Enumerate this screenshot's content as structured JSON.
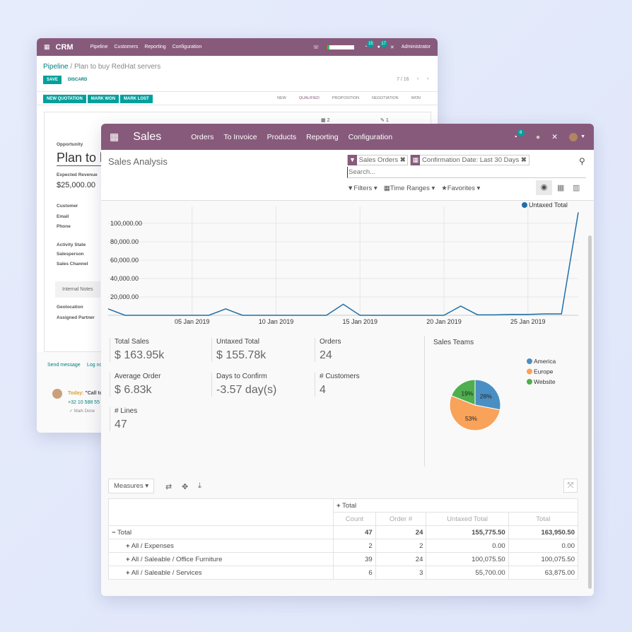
{
  "crm": {
    "app": "CRM",
    "menu": [
      "Pipeline",
      "Customers",
      "Reporting",
      "Configuration"
    ],
    "user": "Administrator",
    "badges": [
      "15",
      "17"
    ],
    "breadcrumb_root": "Pipeline",
    "breadcrumb_current": "Plan to buy RedHat servers",
    "save": "SAVE",
    "discard": "DISCARD",
    "pager": "7 / 16",
    "actions": [
      "NEW QUOTATION",
      "MARK WON",
      "MARK LOST"
    ],
    "stages": [
      "NEW",
      "QUALIFIED",
      "PROPOSITION",
      "NEGOTIATION",
      "WON"
    ],
    "active_stage": "QUALIFIED",
    "stat_buttons": [
      "2",
      "1"
    ],
    "opportunity_label": "Opportunity",
    "opportunity_name": "Plan to buy RedHat servers",
    "expected_revenue_label": "Expected Revenue",
    "expected_revenue": "$25,000.00",
    "fields": [
      "Customer",
      "Email",
      "Phone"
    ],
    "fields2": [
      "Activity State",
      "Salesperson",
      "Sales Channel"
    ],
    "notes_tab": "Internal Notes",
    "fields3": [
      "Geolocation",
      "Assigned Partner"
    ],
    "send_message": "Send message",
    "log_note": "Log note",
    "activity_today": "Today:",
    "activity_title": "\"Call to",
    "activity_phone": "+32 10 588 55",
    "mark_done": "✓ Mark Done"
  },
  "sales": {
    "app": "Sales",
    "menu": [
      "Orders",
      "To Invoice",
      "Products",
      "Reporting",
      "Configuration"
    ],
    "activity_badge": "8",
    "title": "Sales Analysis",
    "facets": [
      {
        "icon": "filter-icon",
        "label": "Sales Orders"
      },
      {
        "icon": "calendar-icon",
        "label": "Confirmation Date: Last 30 Days"
      }
    ],
    "search_placeholder": "Search...",
    "filters": "Filters",
    "time_ranges": "Time Ranges",
    "favorites": "Favorites",
    "kpis": [
      {
        "label": "Total Sales",
        "value": "$ 163.95k"
      },
      {
        "label": "Untaxed Total",
        "value": "$ 155.78k"
      },
      {
        "label": "Orders",
        "value": "24"
      },
      {
        "label": "Average Order",
        "value": "$ 6.83k"
      },
      {
        "label": "Days to Confirm",
        "value": "-3.57 day(s)"
      },
      {
        "label": "# Customers",
        "value": "4"
      },
      {
        "label": "# Lines",
        "value": "47"
      }
    ],
    "measures": "Measures",
    "pivot": {
      "col_header": "Total",
      "measures": [
        "Count",
        "Order #",
        "Untaxed Total",
        "Total"
      ],
      "rows": [
        {
          "label": "Total",
          "values": [
            "47",
            "24",
            "155,775.50",
            "163,950.50"
          ]
        },
        {
          "label": "All / Expenses",
          "values": [
            "2",
            "2",
            "0.00",
            "0.00"
          ]
        },
        {
          "label": "All / Saleable / Office Furniture",
          "values": [
            "39",
            "24",
            "100,075.50",
            "100,075.50"
          ]
        },
        {
          "label": "All / Saleable / Services",
          "values": [
            "6",
            "3",
            "55,700.00",
            "63,875.00"
          ]
        }
      ]
    }
  },
  "chart_data": [
    {
      "type": "line",
      "legend": "Untaxed Total",
      "legend_position": "top-right",
      "color": "#1f6fa8",
      "x": [
        "2018-12-31",
        "2019-01-01",
        "2019-01-02",
        "2019-01-03",
        "2019-01-04",
        "2019-01-05",
        "2019-01-06",
        "2019-01-07",
        "2019-01-08",
        "2019-01-09",
        "2019-01-10",
        "2019-01-11",
        "2019-01-12",
        "2019-01-13",
        "2019-01-14",
        "2019-01-15",
        "2019-01-16",
        "2019-01-17",
        "2019-01-18",
        "2019-01-19",
        "2019-01-20",
        "2019-01-21",
        "2019-01-22",
        "2019-01-23",
        "2019-01-24",
        "2019-01-25",
        "2019-01-26",
        "2019-01-27",
        "2019-01-28"
      ],
      "y": [
        7000,
        0,
        0,
        0,
        0,
        0,
        0,
        7000,
        0,
        0,
        0,
        0,
        0,
        0,
        12000,
        0,
        0,
        0,
        0,
        0,
        0,
        10000,
        500,
        500,
        1000,
        1000,
        1500,
        1500,
        112000
      ],
      "x_ticks": [
        "05 Jan 2019",
        "10 Jan 2019",
        "15 Jan 2019",
        "20 Jan 2019",
        "25 Jan 2019"
      ],
      "y_ticks": [
        "20,000.00",
        "40,000.00",
        "60,000.00",
        "80,000.00",
        "100,000.00"
      ],
      "ylim": [
        0,
        112000
      ],
      "grid": true
    },
    {
      "type": "pie",
      "title": "Sales Teams",
      "labels": [
        "America",
        "Europe",
        "Website"
      ],
      "values": [
        28,
        53,
        19
      ],
      "value_labels": [
        "28%",
        "53%",
        "19%"
      ],
      "colors": [
        "#4a8fc4",
        "#f9a25a",
        "#4fae4f"
      ],
      "legend_position": "top-right"
    }
  ]
}
